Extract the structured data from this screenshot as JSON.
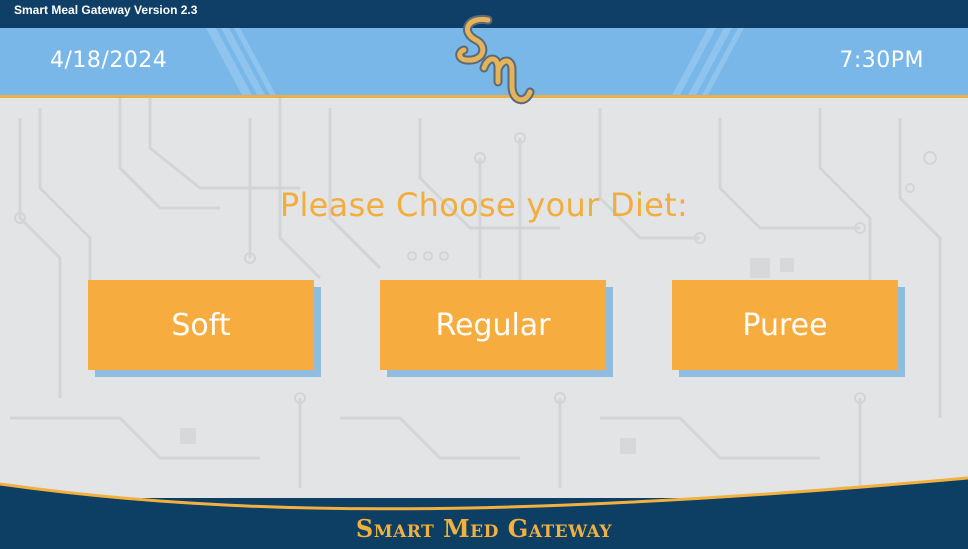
{
  "window": {
    "title": "Smart Meal Gateway Version 2.3"
  },
  "header": {
    "date": "4/18/2024",
    "time": "7:30PM",
    "logo_icon": "sm-monogram-logo-icon"
  },
  "main": {
    "prompt": "Please Choose your Diet:",
    "options": [
      {
        "label": "Soft"
      },
      {
        "label": "Regular"
      },
      {
        "label": "Puree"
      }
    ]
  },
  "footer": {
    "brand": "Smart Med Gateway"
  },
  "colors": {
    "title_bar": "#0f3f66",
    "header_band": "#78b7e8",
    "accent_orange": "#f6ac3e",
    "button_shadow": "#8fbde2",
    "background": "#e3e4e5",
    "footer": "#0d3e63"
  }
}
